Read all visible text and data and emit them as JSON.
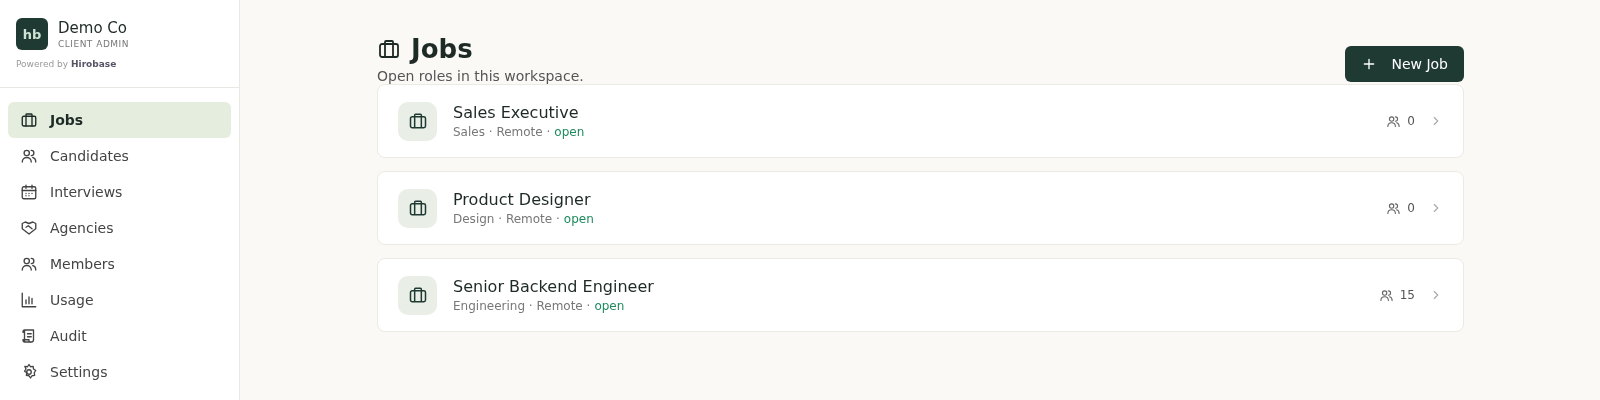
{
  "org": {
    "logo": "hb",
    "name": "Demo Co",
    "role": "CLIENT ADMIN",
    "powered_by": "Powered by",
    "brand": "Hirobase"
  },
  "nav": [
    {
      "label": "Jobs",
      "selected": true
    },
    {
      "label": "Candidates",
      "selected": false
    },
    {
      "label": "Interviews",
      "selected": false
    },
    {
      "label": "Agencies",
      "selected": false
    },
    {
      "label": "Members",
      "selected": false
    },
    {
      "label": "Usage",
      "selected": false
    },
    {
      "label": "Audit",
      "selected": false
    },
    {
      "label": "Settings",
      "selected": false
    }
  ],
  "page": {
    "title": "Jobs",
    "subtitle": "Open roles in this workspace.",
    "new_button": "New Job"
  },
  "jobs": [
    {
      "title": "Sales Executive",
      "meta": "Sales · Remote ·",
      "status": "open",
      "candidates": "0"
    },
    {
      "title": "Product Designer",
      "meta": "Design · Remote ·",
      "status": "open",
      "candidates": "0"
    },
    {
      "title": "Senior Backend Engineer",
      "meta": "Engineering · Remote ·",
      "status": "open",
      "candidates": "15"
    }
  ]
}
